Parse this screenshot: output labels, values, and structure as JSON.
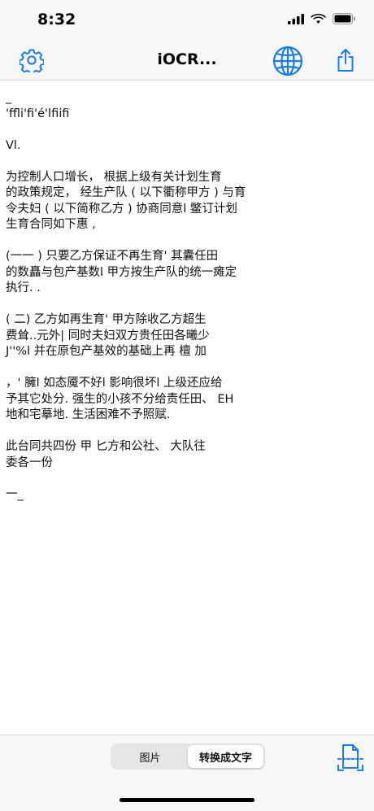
{
  "status_bar": {
    "time": "8:32"
  },
  "nav": {
    "title": "iOCR..."
  },
  "ocr_text": "_\n'ffli'fi'é'lfiifi\n\nVl.\n\n为控制人口增长， 根据上级有关计划生育\n的政策规定， 经生产队 ( 以下衢称甲方 ) 与育\n令夫妇 ( 以下简称乙方 ) 协商同意l 鳖订计划\n生育合同如下惠 ,\n\n(一一 ) 只要乙方保证不再生育' 其囊任田\n的数矗与包产基数l 甲方按生产队的统一瘫定\n执行. .\n\n( 二) 乙方如再生育' 甲方除收乙方超生\n费耸..元外| 同时夫妇双方贵任田各曦少\nJ''%l 并在原包产基效的基础上再 檀 加\n\n，' 臃l 如态魇不好l 影响很坏l 上级还应给\n予其它处分. 强生的小孩不分给责任田、 EH\n地和宅摹地. 生活困难不予照赋.\n\n此台同共四份 甲 匕方和公社、 大队往\n委各一份\n\n一_",
  "segmented": {
    "image_label": "图片",
    "text_label": "转换成文字",
    "selected": "text"
  },
  "colors": {
    "accent": "#1a7cf0",
    "bar_background": "#f7f7f7"
  }
}
